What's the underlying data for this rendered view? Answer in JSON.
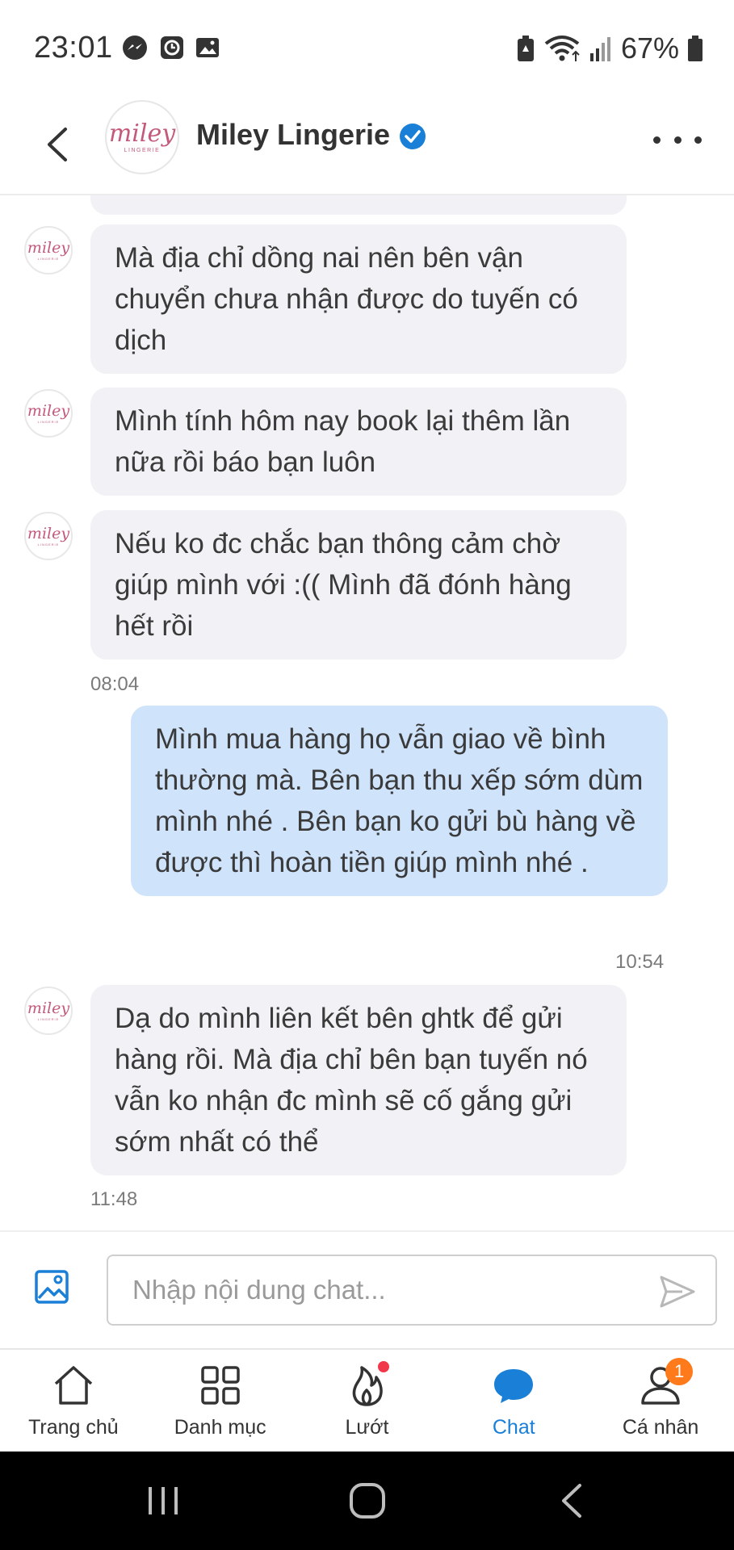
{
  "status_bar": {
    "time": "23:01",
    "battery": "67%",
    "notification_icons": [
      "messenger-icon",
      "clock-icon",
      "image-icon"
    ],
    "system_icons": [
      "battery-saver-icon",
      "wifi-icon",
      "signal-icon",
      "battery-icon"
    ]
  },
  "header": {
    "shop_name": "Miley Lingerie",
    "avatar_logo": "miley",
    "avatar_sub": "LINGERIE",
    "verified": true
  },
  "messages": [
    {
      "side": "in",
      "text": "Mà địa chỉ dồng nai nên bên vận chuyển chưa nhận được do tuyến có dịch"
    },
    {
      "side": "in",
      "text": "Mình tính hôm nay book lại thêm lần nữa rồi báo bạn luôn"
    },
    {
      "side": "in",
      "text": "Nếu ko đc chắc bạn thông cảm chờ giúp mình với :(( Mình đã đónh hàng hết rồi",
      "time": "08:04"
    },
    {
      "side": "out",
      "text": "Mình mua hàng họ vẫn giao về bình thường mà. Bên bạn thu xếp sớm dùm mình nhé . Bên bạn ko gửi bù hàng về được thì hoàn tiền giúp mình nhé .",
      "time": "10:54"
    },
    {
      "side": "in",
      "text": "Dạ do mình liên kết bên ghtk để gửi hàng rồi. Mà địa chỉ bên bạn tuyến nó vẫn ko nhận đc mình sẽ cố gắng gửi sớm nhất có thể",
      "time": "11:48"
    }
  ],
  "input": {
    "placeholder": "Nhập nội dung chat..."
  },
  "nav": {
    "items": [
      {
        "label": "Trang chủ",
        "icon": "home-icon"
      },
      {
        "label": "Danh mục",
        "icon": "grid-icon"
      },
      {
        "label": "Lướt",
        "icon": "flame-icon",
        "dot": true
      },
      {
        "label": "Chat",
        "icon": "chat-bubble-icon",
        "active": true
      },
      {
        "label": "Cá nhân",
        "icon": "user-icon",
        "badge": "1"
      }
    ]
  },
  "colors": {
    "accent": "#1a7fd6",
    "incoming_bubble": "#f2f2f6",
    "outgoing_bubble": "#cfe3fb",
    "badge": "#ff7a1a",
    "dot": "#f0384a",
    "logo": "#c45a7a"
  }
}
